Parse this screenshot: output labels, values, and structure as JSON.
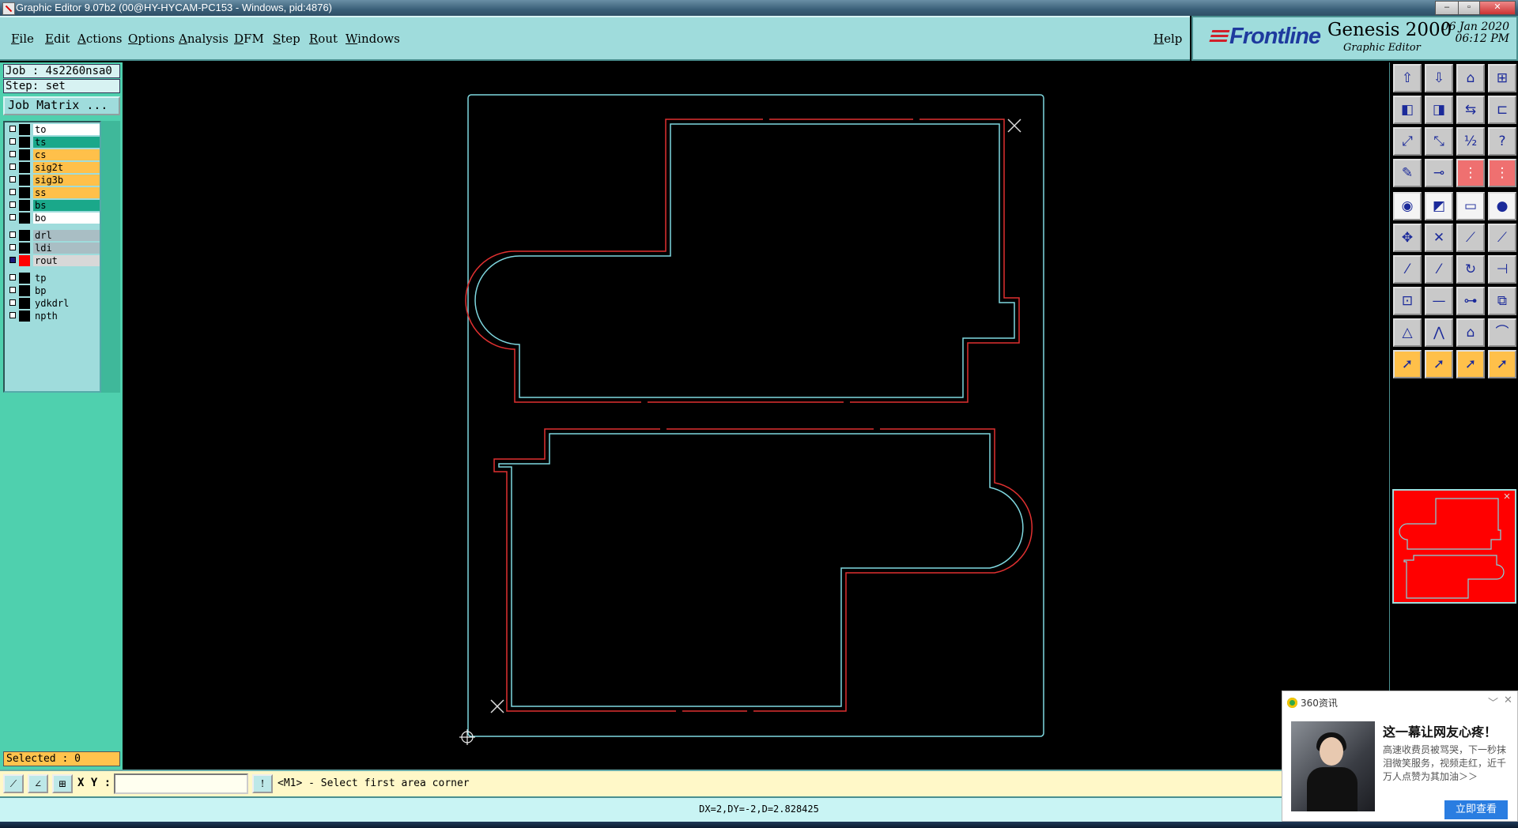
{
  "window": {
    "title": "Graphic Editor 9.07b2 (00@HY-HYCAM-PC153 - Windows, pid:4876)",
    "buttons": [
      "–",
      "▫",
      "✕"
    ]
  },
  "menu": {
    "items": [
      "File",
      "Edit",
      "Actions",
      "Options",
      "Analysis",
      "DFM",
      "Step",
      "Rout",
      "Windows"
    ],
    "help": "Help"
  },
  "brand": {
    "logo": "Frontline",
    "product": "Genesis 2000",
    "subtitle": "Graphic Editor",
    "date": "06 Jan 2020",
    "time": "06:12 PM"
  },
  "job": {
    "job_label": "Job : 4s2260nsa0",
    "step_label": "Step: set",
    "matrix_button": "Job Matrix ..."
  },
  "layers": [
    {
      "name": "to",
      "color": "#ffffff",
      "checked": false
    },
    {
      "name": "ts",
      "color": "#1aa88a",
      "checked": false
    },
    {
      "name": "cs",
      "color": "#ffc04a",
      "checked": false
    },
    {
      "name": "sig2t",
      "color": "#ffc04a",
      "checked": false
    },
    {
      "name": "sig3b",
      "color": "#ffc04a",
      "checked": false
    },
    {
      "name": "ss",
      "color": "#ffc04a",
      "checked": false
    },
    {
      "name": "bs",
      "color": "#1aa88a",
      "checked": false
    },
    {
      "name": "bo",
      "color": "#ffffff",
      "checked": false
    },
    {
      "name": "drl",
      "color": "#a9bec4",
      "checked": false
    },
    {
      "name": "ldi",
      "color": "#a9bec4",
      "checked": false
    },
    {
      "name": "rout",
      "color": "#d8d8d8",
      "checked": true,
      "swatch": "#ff0000"
    },
    {
      "name": "tp",
      "color": "#9fdcdc",
      "checked": false
    },
    {
      "name": "bp",
      "color": "#9fdcdc",
      "checked": false
    },
    {
      "name": "ydkdrl",
      "color": "#9fdcdc",
      "checked": false
    },
    {
      "name": "npth",
      "color": "#9fdcdc",
      "checked": false
    }
  ],
  "selected": "Selected : 0",
  "command": {
    "xy_label": "X Y :",
    "xy_value": "",
    "prompt": "<M1> - Select first area corner",
    "info_button": "!"
  },
  "status": "DX=2,DY=-2,D=2.828425",
  "colors": {
    "board_outline": "#7fd8e0",
    "rout_path": "#e03030",
    "panel_bg": "#9fdcdc",
    "left_bg": "#4fd0ae"
  },
  "toolbar_icons": [
    "zoom-home-icon",
    "zoom-window-icon",
    "home-icon",
    "grid-icon",
    "pan-left-icon",
    "pan-right-icon",
    "mirror-icon",
    "snap-icon",
    "fit-icon",
    "center-icon",
    "scale-1-2-icon",
    "help-query-icon",
    "measure-icon",
    "rout-icon",
    "layers-red-icon",
    "layers-red2-icon",
    "pad-icon",
    "select-poly-icon",
    "ruler-icon",
    "circle-icon",
    "move-icon",
    "cross-icon",
    "node-icon",
    "node-red-icon",
    "line-icon",
    "line-red-icon",
    "rotate-icon",
    "split-icon",
    "snap-red-icon",
    "minus-icon",
    "dim-icon",
    "drill-icon",
    "arc-icon",
    "arc-red-icon",
    "arc-blue-icon",
    "arc-red2-icon",
    "pointer-icon",
    "pointer-select-icon",
    "pointer-add-icon",
    "pointer-route-icon"
  ],
  "popup": {
    "source": "360资讯",
    "title": "这一幕让网友心疼！",
    "desc": "高速收费员被骂哭，下一秒抹泪微笑服务，视频走红，近千万人点赞为其加油＞＞",
    "cta": "立即查看",
    "min": "﹀",
    "close": "✕"
  }
}
